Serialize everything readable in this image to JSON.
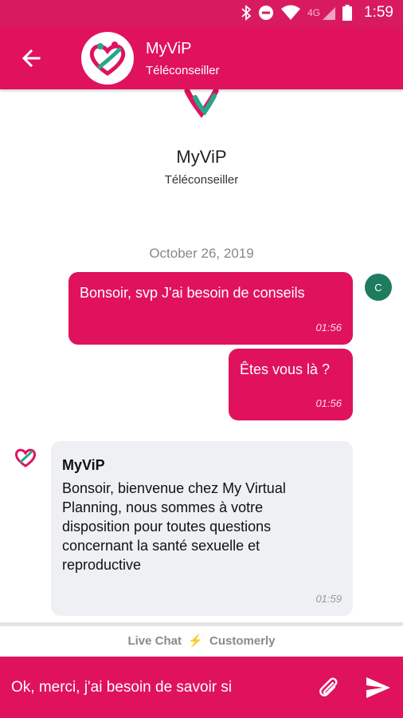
{
  "status_bar": {
    "network": "4G",
    "time": "1:59"
  },
  "header": {
    "title": "MyViP",
    "subtitle": "Téléconseiller"
  },
  "profile": {
    "name": "MyViP",
    "role": "Téléconseiller"
  },
  "conversation": {
    "date": "October 26, 2019",
    "user_initial": "C",
    "messages": [
      {
        "direction": "outgoing",
        "text": "Bonsoir, svp J'ai besoin de conseils",
        "time": "01:56"
      },
      {
        "direction": "outgoing",
        "text": "Êtes vous là ?",
        "time": "01:56"
      },
      {
        "direction": "incoming",
        "sender": "MyViP",
        "text": "Bonsoir, bienvenue chez My Virtual Planning, nous sommes à votre disposition pour toutes questions concernant la santé sexuelle et reproductive",
        "time": "01:59"
      }
    ]
  },
  "footer": {
    "powered_prefix": "Live Chat",
    "powered_brand": "Customerly"
  },
  "composer": {
    "value": "Ok, merci, j'ai besoin de savoir si"
  },
  "colors": {
    "brand": "#e0125e",
    "status_bar": "#d81b60",
    "user_avatar": "#1e7b5e",
    "incoming_bubble": "#eef0f4"
  },
  "icons": [
    "back-arrow-icon",
    "bluetooth-icon",
    "do-not-disturb-icon",
    "wifi-icon",
    "signal-icon",
    "battery-icon",
    "attach-icon",
    "send-icon"
  ]
}
